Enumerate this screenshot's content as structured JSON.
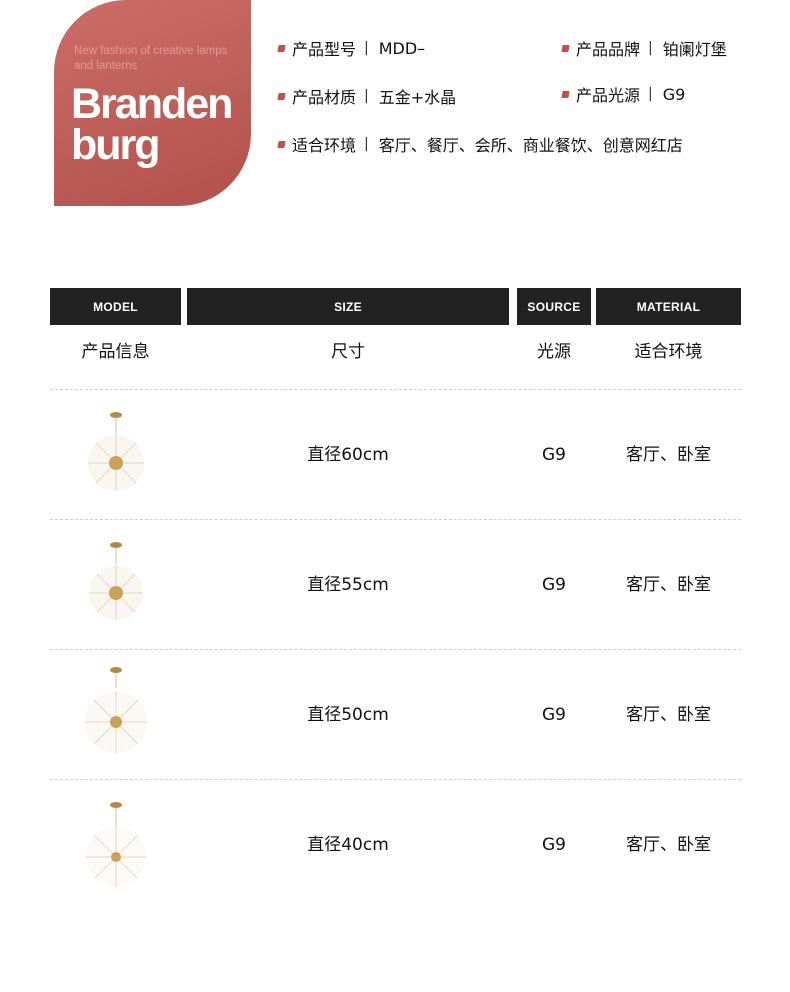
{
  "brand": {
    "tagline": "New fashion of creative lamps and lanterns",
    "name_line1": "Branden",
    "name_line2": "burg",
    "color": "#b85650"
  },
  "specs": {
    "model_label": "产品型号",
    "model_value": "MDD–",
    "brand_label": "产品品牌",
    "brand_value": "铂阑灯堡",
    "material_label": "产品材质",
    "material_value": "五金+水晶",
    "light_label": "产品光源",
    "light_value": "G9",
    "env_label": "适合环境",
    "env_value": "客厅、餐厅、会所、商业餐饮、创意网红店",
    "separator": "|"
  },
  "table": {
    "headers": [
      "MODEL",
      "SIZE",
      "SOURCE",
      "MATERIAL"
    ],
    "subheaders": [
      "产品信息",
      "尺寸",
      "光源",
      "适合环境"
    ],
    "rows": [
      {
        "size": "直径60cm",
        "source": "G9",
        "environment": "客厅、卧室",
        "image": "crystal-chandelier-icon"
      },
      {
        "size": "直径55cm",
        "source": "G9",
        "environment": "客厅、卧室",
        "image": "crystal-chandelier-icon"
      },
      {
        "size": "直径50cm",
        "source": "G9",
        "environment": "客厅、卧室",
        "image": "crystal-chandelier-icon"
      },
      {
        "size": "直径40cm",
        "source": "G9",
        "environment": "客厅、卧室",
        "image": "crystal-chandelier-icon"
      }
    ]
  }
}
